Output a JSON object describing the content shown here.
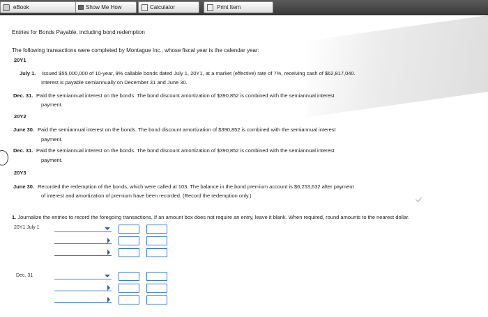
{
  "toolbar": {
    "ebook": "eBook",
    "show_me_how": "Show Me How",
    "calculator": "Calculator",
    "print_item": "Print Item"
  },
  "problem": {
    "title": "Entries for Bonds Payable, including bond redemption",
    "intro": "The following transactions were completed by Montague Inc., whose fiscal year is the calendar year:",
    "year1": "20Y1",
    "t1_date": "July 1.",
    "t1_line1": "Issued $55,000,000 of 10-year, 9% callable bonds dated July 1, 20Y1, at a market (effective) rate of 7%, receiving cash of $62,817,040.",
    "t1_line2": "Interest is payable semiannually on December 31 and June 30.",
    "t2_date": "Dec. 31.",
    "t2_line1": "Paid the semiannual interest on the bonds. The bond discount amortization of $390,852 is combined with the semiannual interest",
    "t2_line2": "payment.",
    "year2": "20Y2",
    "t3_date": "June 30.",
    "t3_line1": "Paid the semiannual interest on the bonds. The bond discount amortization of $390,852 is combined with the semiannual interest",
    "t3_line2": "payment.",
    "t4_date": "Dec. 31.",
    "t4_line1": "Paid the semiannual interest on the bonds. The bond discount amortization of $390,852 is combined with the semiannual interest",
    "t4_line2": "payment.",
    "year3": "20Y3",
    "t5_date": "June 30.",
    "t5_line1": "Recorded the redemption of the bonds, which were called at 103. The balance in the bond premium account is $6,253,632 after payment",
    "t5_line2": "of interest and amortization of premium have been recorded. (Record the redemption only.)"
  },
  "question": {
    "number": "1.",
    "text": "Journalize the entries to record the foregoing transactions. If an amount box does not require an entry, leave it blank. When required, round amounts to the nearest dollar.",
    "entry1_date": "20Y1 July 1",
    "entry2_date": "Dec. 31"
  },
  "icons": [
    "ebook-icon",
    "show-me-how-icon",
    "calculator-icon",
    "print-icon",
    "dropdown-arrow-icon"
  ]
}
